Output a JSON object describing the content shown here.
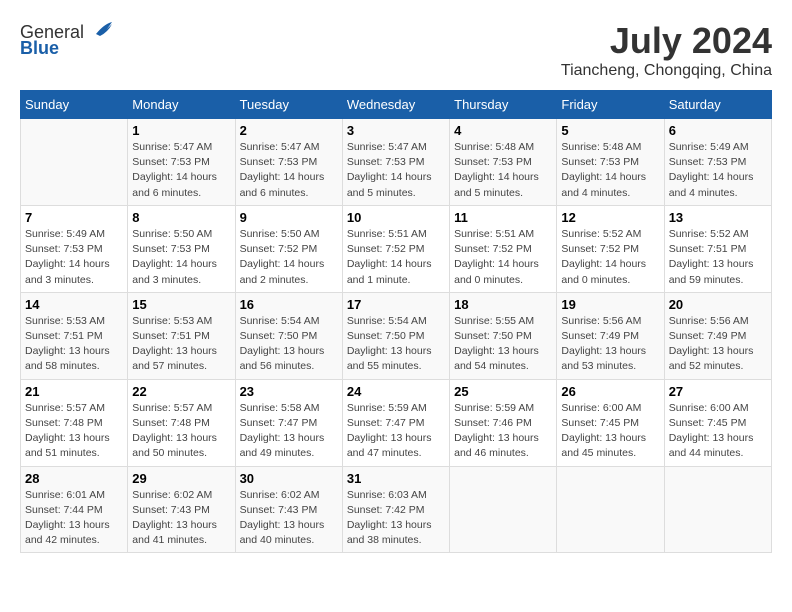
{
  "header": {
    "logo_general": "General",
    "logo_blue": "Blue",
    "main_title": "July 2024",
    "subtitle": "Tiancheng, Chongqing, China"
  },
  "columns": [
    "Sunday",
    "Monday",
    "Tuesday",
    "Wednesday",
    "Thursday",
    "Friday",
    "Saturday"
  ],
  "weeks": [
    {
      "cells": [
        {
          "day": "",
          "info": ""
        },
        {
          "day": "1",
          "info": "Sunrise: 5:47 AM\nSunset: 7:53 PM\nDaylight: 14 hours\nand 6 minutes."
        },
        {
          "day": "2",
          "info": "Sunrise: 5:47 AM\nSunset: 7:53 PM\nDaylight: 14 hours\nand 6 minutes."
        },
        {
          "day": "3",
          "info": "Sunrise: 5:47 AM\nSunset: 7:53 PM\nDaylight: 14 hours\nand 5 minutes."
        },
        {
          "day": "4",
          "info": "Sunrise: 5:48 AM\nSunset: 7:53 PM\nDaylight: 14 hours\nand 5 minutes."
        },
        {
          "day": "5",
          "info": "Sunrise: 5:48 AM\nSunset: 7:53 PM\nDaylight: 14 hours\nand 4 minutes."
        },
        {
          "day": "6",
          "info": "Sunrise: 5:49 AM\nSunset: 7:53 PM\nDaylight: 14 hours\nand 4 minutes."
        }
      ]
    },
    {
      "cells": [
        {
          "day": "7",
          "info": "Sunrise: 5:49 AM\nSunset: 7:53 PM\nDaylight: 14 hours\nand 3 minutes."
        },
        {
          "day": "8",
          "info": "Sunrise: 5:50 AM\nSunset: 7:53 PM\nDaylight: 14 hours\nand 3 minutes."
        },
        {
          "day": "9",
          "info": "Sunrise: 5:50 AM\nSunset: 7:52 PM\nDaylight: 14 hours\nand 2 minutes."
        },
        {
          "day": "10",
          "info": "Sunrise: 5:51 AM\nSunset: 7:52 PM\nDaylight: 14 hours\nand 1 minute."
        },
        {
          "day": "11",
          "info": "Sunrise: 5:51 AM\nSunset: 7:52 PM\nDaylight: 14 hours\nand 0 minutes."
        },
        {
          "day": "12",
          "info": "Sunrise: 5:52 AM\nSunset: 7:52 PM\nDaylight: 14 hours\nand 0 minutes."
        },
        {
          "day": "13",
          "info": "Sunrise: 5:52 AM\nSunset: 7:51 PM\nDaylight: 13 hours\nand 59 minutes."
        }
      ]
    },
    {
      "cells": [
        {
          "day": "14",
          "info": "Sunrise: 5:53 AM\nSunset: 7:51 PM\nDaylight: 13 hours\nand 58 minutes."
        },
        {
          "day": "15",
          "info": "Sunrise: 5:53 AM\nSunset: 7:51 PM\nDaylight: 13 hours\nand 57 minutes."
        },
        {
          "day": "16",
          "info": "Sunrise: 5:54 AM\nSunset: 7:50 PM\nDaylight: 13 hours\nand 56 minutes."
        },
        {
          "day": "17",
          "info": "Sunrise: 5:54 AM\nSunset: 7:50 PM\nDaylight: 13 hours\nand 55 minutes."
        },
        {
          "day": "18",
          "info": "Sunrise: 5:55 AM\nSunset: 7:50 PM\nDaylight: 13 hours\nand 54 minutes."
        },
        {
          "day": "19",
          "info": "Sunrise: 5:56 AM\nSunset: 7:49 PM\nDaylight: 13 hours\nand 53 minutes."
        },
        {
          "day": "20",
          "info": "Sunrise: 5:56 AM\nSunset: 7:49 PM\nDaylight: 13 hours\nand 52 minutes."
        }
      ]
    },
    {
      "cells": [
        {
          "day": "21",
          "info": "Sunrise: 5:57 AM\nSunset: 7:48 PM\nDaylight: 13 hours\nand 51 minutes."
        },
        {
          "day": "22",
          "info": "Sunrise: 5:57 AM\nSunset: 7:48 PM\nDaylight: 13 hours\nand 50 minutes."
        },
        {
          "day": "23",
          "info": "Sunrise: 5:58 AM\nSunset: 7:47 PM\nDaylight: 13 hours\nand 49 minutes."
        },
        {
          "day": "24",
          "info": "Sunrise: 5:59 AM\nSunset: 7:47 PM\nDaylight: 13 hours\nand 47 minutes."
        },
        {
          "day": "25",
          "info": "Sunrise: 5:59 AM\nSunset: 7:46 PM\nDaylight: 13 hours\nand 46 minutes."
        },
        {
          "day": "26",
          "info": "Sunrise: 6:00 AM\nSunset: 7:45 PM\nDaylight: 13 hours\nand 45 minutes."
        },
        {
          "day": "27",
          "info": "Sunrise: 6:00 AM\nSunset: 7:45 PM\nDaylight: 13 hours\nand 44 minutes."
        }
      ]
    },
    {
      "cells": [
        {
          "day": "28",
          "info": "Sunrise: 6:01 AM\nSunset: 7:44 PM\nDaylight: 13 hours\nand 42 minutes."
        },
        {
          "day": "29",
          "info": "Sunrise: 6:02 AM\nSunset: 7:43 PM\nDaylight: 13 hours\nand 41 minutes."
        },
        {
          "day": "30",
          "info": "Sunrise: 6:02 AM\nSunset: 7:43 PM\nDaylight: 13 hours\nand 40 minutes."
        },
        {
          "day": "31",
          "info": "Sunrise: 6:03 AM\nSunset: 7:42 PM\nDaylight: 13 hours\nand 38 minutes."
        },
        {
          "day": "",
          "info": ""
        },
        {
          "day": "",
          "info": ""
        },
        {
          "day": "",
          "info": ""
        }
      ]
    }
  ]
}
